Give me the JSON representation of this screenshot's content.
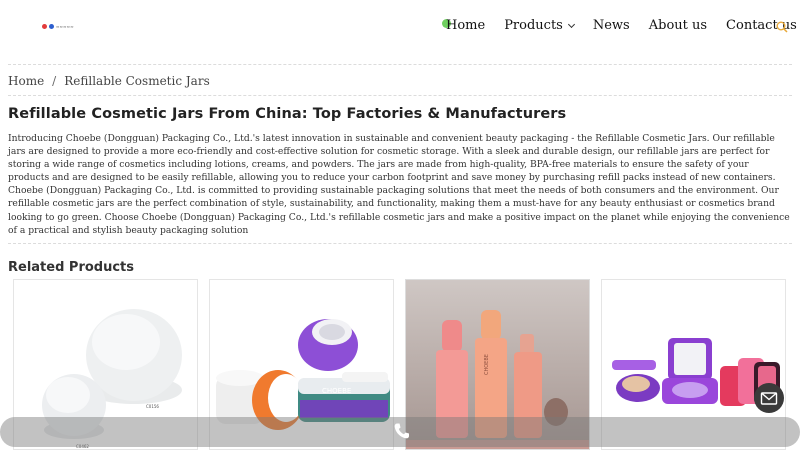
{
  "header": {
    "nav": [
      {
        "label": "Home"
      },
      {
        "label": "Products"
      },
      {
        "label": "News"
      },
      {
        "label": "About us"
      },
      {
        "label": "Contact us"
      }
    ],
    "search_icon": "search-icon",
    "accent_color": "#e8a93a"
  },
  "breadcrumb": {
    "home": "Home",
    "separator": "/",
    "current": "Refillable Cosmetic Jars"
  },
  "main": {
    "title": "Refillable Cosmetic Jars From China: Top Factories & Manufacturers",
    "intro": "Introducing Choebe (Dongguan) Packaging Co., Ltd.'s latest innovation in sustainable and convenient beauty packaging - the Refillable Cosmetic Jars. Our refillable jars are designed to provide a more eco-friendly and cost-effective solution for cosmetic storage. With a sleek and durable design, our refillable jars are perfect for storing a wide range of cosmetics including lotions, creams, and powders. The jars are made from high-quality, BPA-free materials to ensure the safety of your products and are designed to be easily refillable, allowing you to reduce your carbon footprint and save money by purchasing refill packs instead of new containers. Choebe (Dongguan) Packaging Co., Ltd. is committed to providing sustainable packaging solutions that meet the needs of both consumers and the environment. Our refillable cosmetic jars are the perfect combination of style, sustainability, and functionality, making them a must-have for any beauty enthusiast or cosmetics brand looking to go green. Choose Choebe (Dongguan) Packaging Co., Ltd.'s refillable cosmetic jars and make a positive impact on the planet while enjoying the convenience of a practical and stylish beauty packaging solution"
  },
  "related": {
    "title": "Related Products",
    "products": [
      {
        "image": "white-round-compacts",
        "label_a": "C0156",
        "label_b": "C0462"
      },
      {
        "image": "cream-jars-set",
        "brand": "CHOEBE"
      },
      {
        "image": "pink-bottles-set",
        "brand": "CHOEBE"
      },
      {
        "image": "purple-compact-set"
      }
    ]
  },
  "footer": {
    "phone_icon": "phone-icon",
    "mail_icon": "mail-icon"
  }
}
